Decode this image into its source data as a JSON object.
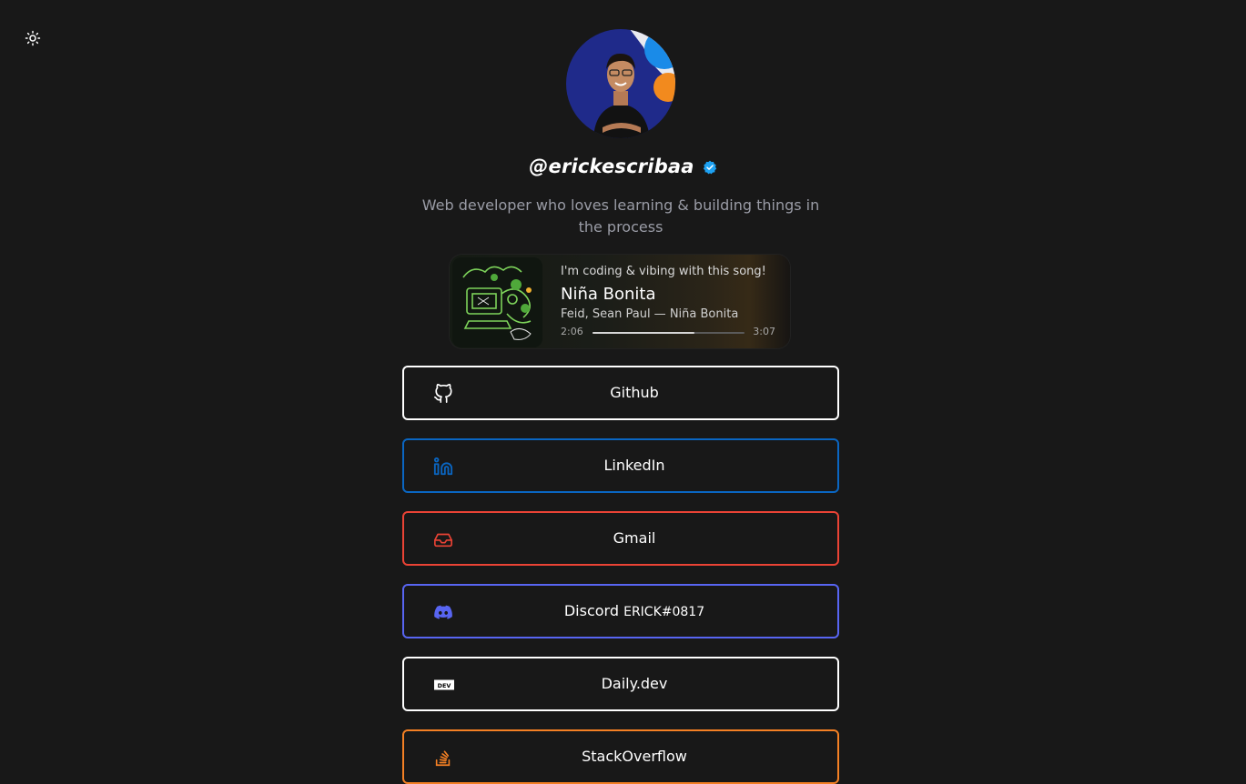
{
  "theme_toggle": {
    "icon": "sun-icon"
  },
  "profile": {
    "handle": "@erickescribaa",
    "verified_icon": "verified-badge-icon",
    "bio": "Web developer who loves learning & building things in the process"
  },
  "now_playing": {
    "caption": "I'm coding & vibing with this song!",
    "title": "Niña Bonita",
    "artists": "Feid, Sean Paul — Niña Bonita",
    "elapsed": "2:06",
    "duration": "3:07",
    "progress": 0.67
  },
  "links": [
    {
      "label": "Github",
      "icon": "github-icon",
      "color": "#ffffff"
    },
    {
      "label": "LinkedIn",
      "icon": "linkedin-icon",
      "color": "#0a66c2"
    },
    {
      "label": "Gmail",
      "icon": "inbox-icon",
      "color": "#ea4335"
    },
    {
      "label": "Discord",
      "tag": "ERICK#0817",
      "icon": "discord-icon",
      "color": "#5865f2"
    },
    {
      "label": "Daily.dev",
      "icon": "dev-icon",
      "color": "#ffffff"
    },
    {
      "label": "StackOverflow",
      "icon": "stackoverflow-icon",
      "color": "#f48024"
    }
  ]
}
